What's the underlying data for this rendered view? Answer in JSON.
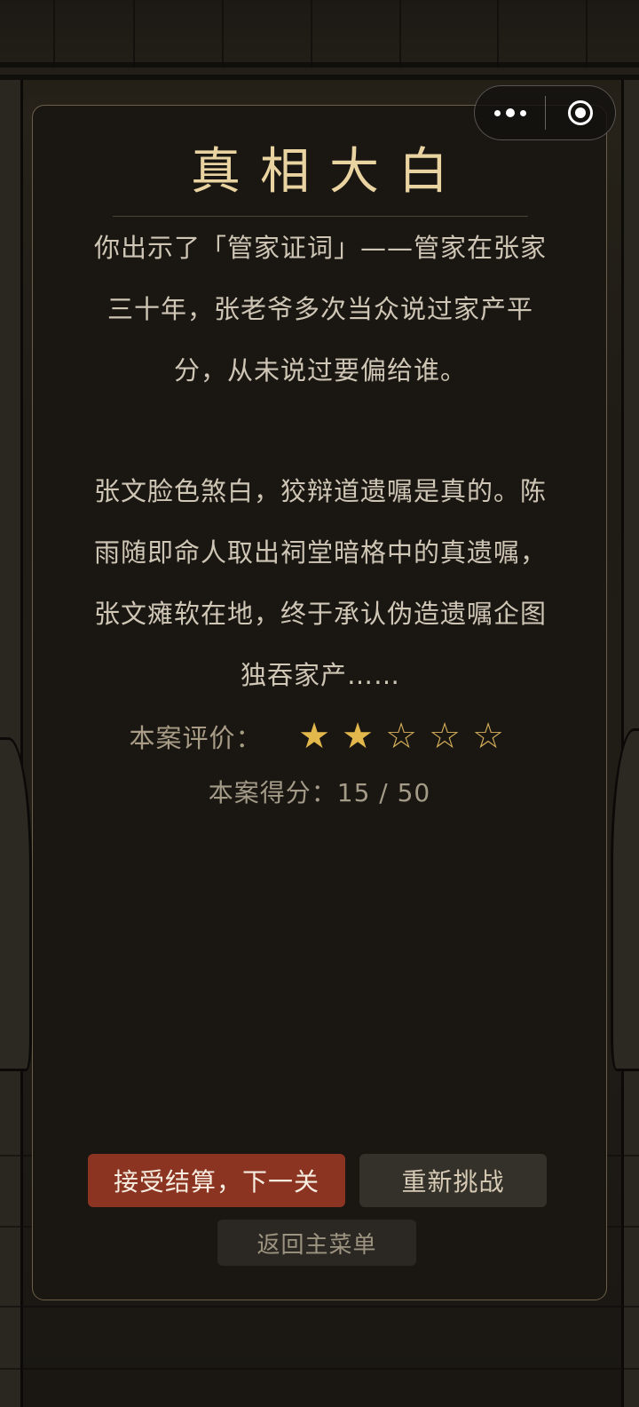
{
  "result": {
    "title": "真相大白",
    "paragraph1": "你出示了「管家证词」——管家在张家三十年，张老爷多次当众说过家产平分，从未说过要偏给谁。",
    "paragraph2": "张文脸色煞白，狡辩道遗嘱是真的。陈雨随即命人取出祠堂暗格中的真遗嘱，张文瘫软在地，终于承认伪造遗嘱企图独吞家产……",
    "rating_label": "本案评价：",
    "rating": {
      "value": 2,
      "max": 5
    },
    "stars": [
      "★",
      "★",
      "☆",
      "☆",
      "☆"
    ],
    "score_text": "本案得分：15 / 50"
  },
  "buttons": {
    "accept": "接受结算，下一关",
    "retry": "重新挑战",
    "menu": "返回主菜单"
  },
  "capsule": {
    "more_icon": "more-dots-icon",
    "close_icon": "close-target-icon"
  },
  "colors": {
    "title": "#e8d3a1",
    "accent_button": "#8b3422",
    "star": "#e2b84c",
    "panel_border": "#6b5e48"
  }
}
